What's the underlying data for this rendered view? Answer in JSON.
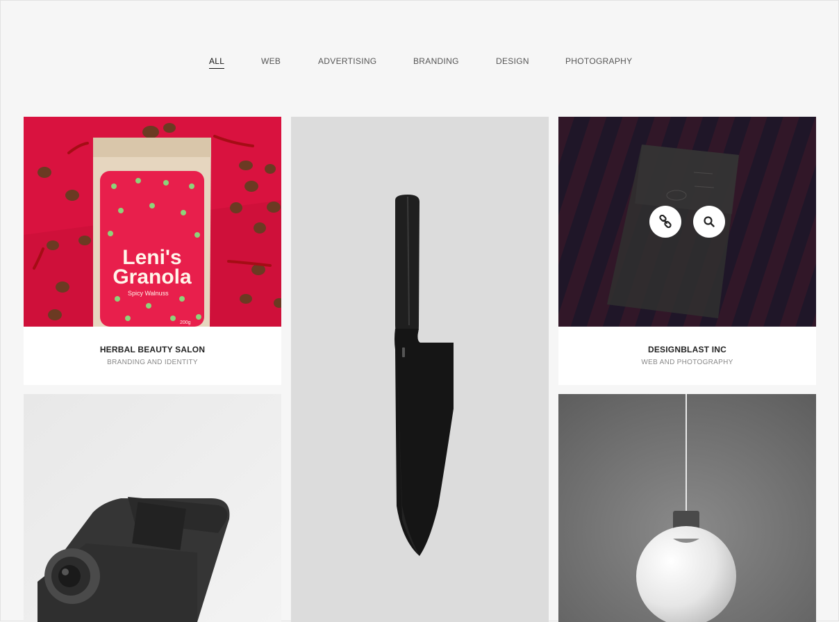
{
  "filters": [
    {
      "label": "ALL",
      "active": true
    },
    {
      "label": "WEB",
      "active": false
    },
    {
      "label": "ADVERTISING",
      "active": false
    },
    {
      "label": "BRANDING",
      "active": false
    },
    {
      "label": "DESIGN",
      "active": false
    },
    {
      "label": "PHOTOGRAPHY",
      "active": false
    }
  ],
  "portfolio": {
    "items": [
      {
        "title": "HERBAL BEAUTY SALON",
        "subtitle": "BRANDING AND IDENTITY",
        "image": {
          "subject": "granola-package",
          "package_text_line1": "Leni's",
          "package_text_line2": "Granola",
          "package_text_line3": "Spicy Walnuss",
          "package_weight": "200g"
        }
      },
      {
        "title": "",
        "subtitle": "",
        "image": {
          "subject": "black-chef-knife"
        }
      },
      {
        "title": "DESIGNBLAST INC",
        "subtitle": "WEB AND PHOTOGRAPHY",
        "image": {
          "subject": "dark-stationery-box"
        },
        "hover_actions": [
          {
            "icon": "link-icon"
          },
          {
            "icon": "search-icon"
          }
        ]
      },
      {
        "title": "",
        "subtitle": "",
        "image": {
          "subject": "grey-camera"
        }
      },
      {
        "title": "",
        "subtitle": "",
        "image": {
          "subject": "pendant-lamp"
        }
      }
    ]
  },
  "colors": {
    "page_background": "#f6f6f6",
    "card_background": "#ffffff",
    "title_text": "#222222",
    "subtitle_text": "#888888",
    "nav_text": "#555555",
    "nav_active": "#111111",
    "granola_red": "#d9123f",
    "granola_green": "#8ed27a",
    "stationery_dark": "#2a1e33"
  }
}
